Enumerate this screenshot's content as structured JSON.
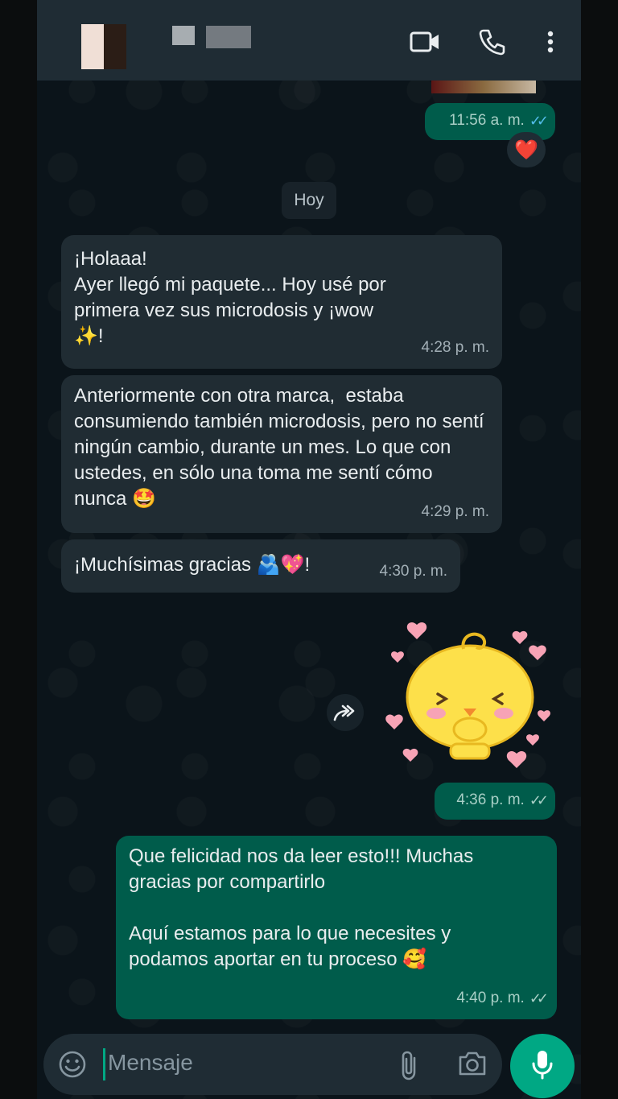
{
  "header": {
    "contact_name": "",
    "icons": [
      "video-call-icon",
      "phone-call-icon",
      "more-options-icon"
    ]
  },
  "messages": [
    {
      "id": "out-1",
      "time": "11:56 a. m.",
      "reaction": "❤️"
    },
    {
      "id": "day",
      "label": "Hoy"
    },
    {
      "id": "in-1",
      "text": "¡Holaaa!\nAyer llegó mi paquete... Hoy usé por primera vez sus microdosis y ¡wow ✨!",
      "time": "4:28 p. m."
    },
    {
      "id": "in-2",
      "text": "Anteriormente con otra marca,  estaba consumiendo también microdosis, pero no sentí ningún cambio, durante un mes. Lo que con ustedes, en sólo una toma me sentí cómo nunca 🤩",
      "time": "4:29 p. m."
    },
    {
      "id": "in-3",
      "text": "¡Muchísimas gracias 🫂💖!",
      "time": "4:30 p. m."
    },
    {
      "id": "sticker",
      "time": "4:36 p. m."
    },
    {
      "id": "out-2",
      "text": "Que felicidad nos da leer esto!!! Muchas gracias por compartirlo\n\nAquí estamos para lo que necesites y podamos aportar en tu proceso 🥰",
      "time": "4:40 p. m."
    }
  ],
  "composer": {
    "placeholder": "Mensaje"
  },
  "colors": {
    "incoming_bubble": "#202c33",
    "outgoing_bubble": "#005c4b",
    "accent": "#00a884",
    "read_tick": "#53bdeb"
  }
}
